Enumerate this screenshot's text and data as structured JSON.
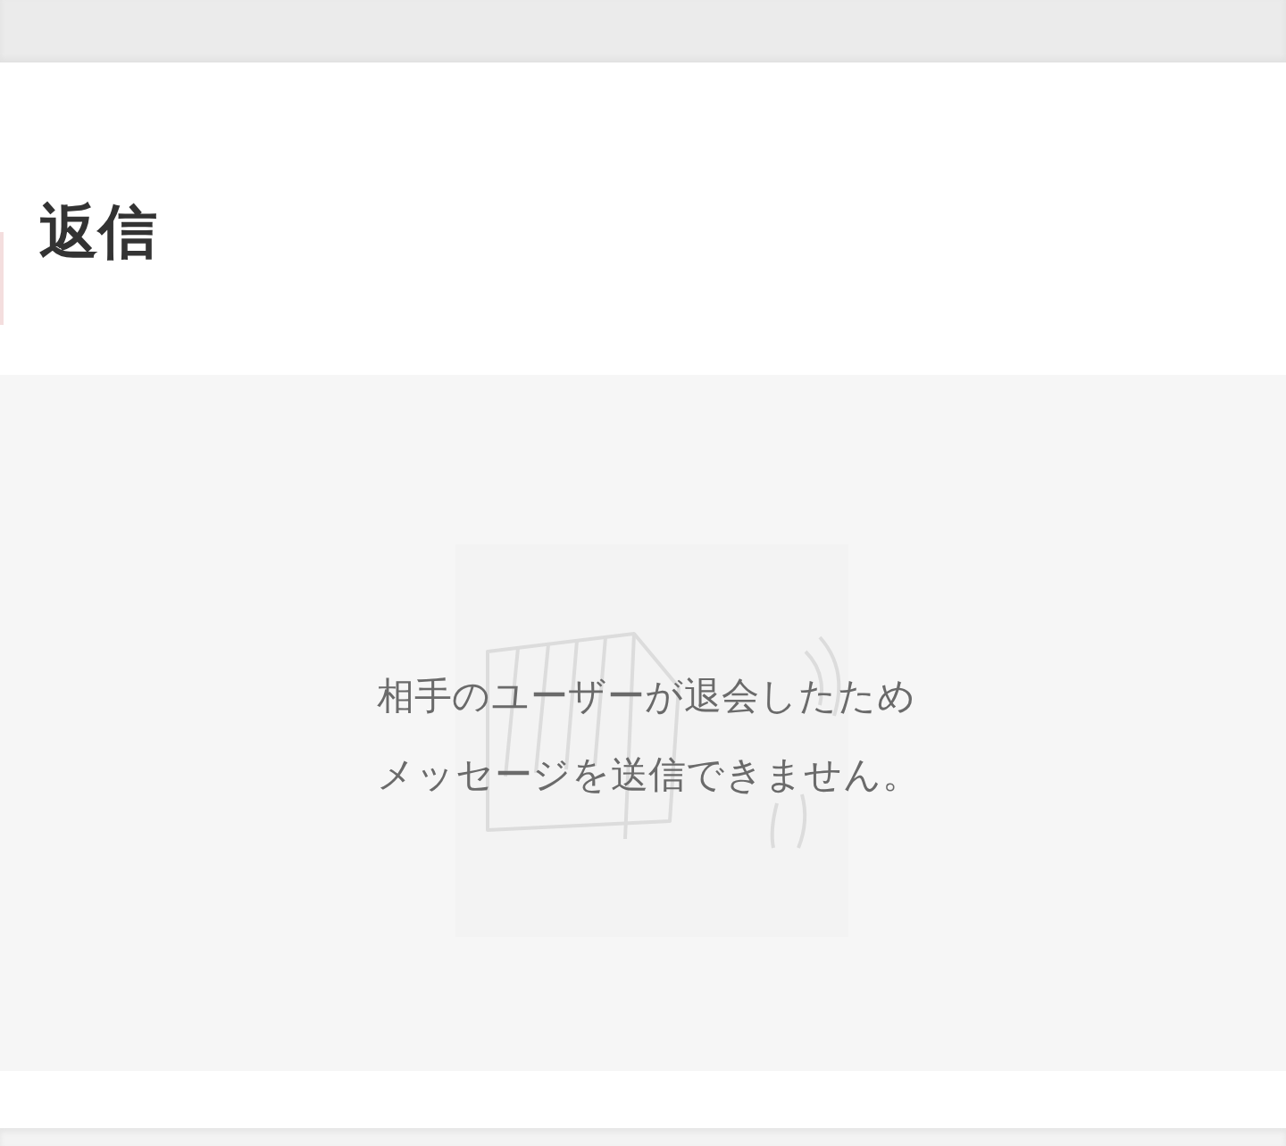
{
  "header": {
    "title": "返信"
  },
  "notice": {
    "lines": [
      "相手のユーザーが退会したため",
      "メッセージを送信できません。"
    ]
  }
}
